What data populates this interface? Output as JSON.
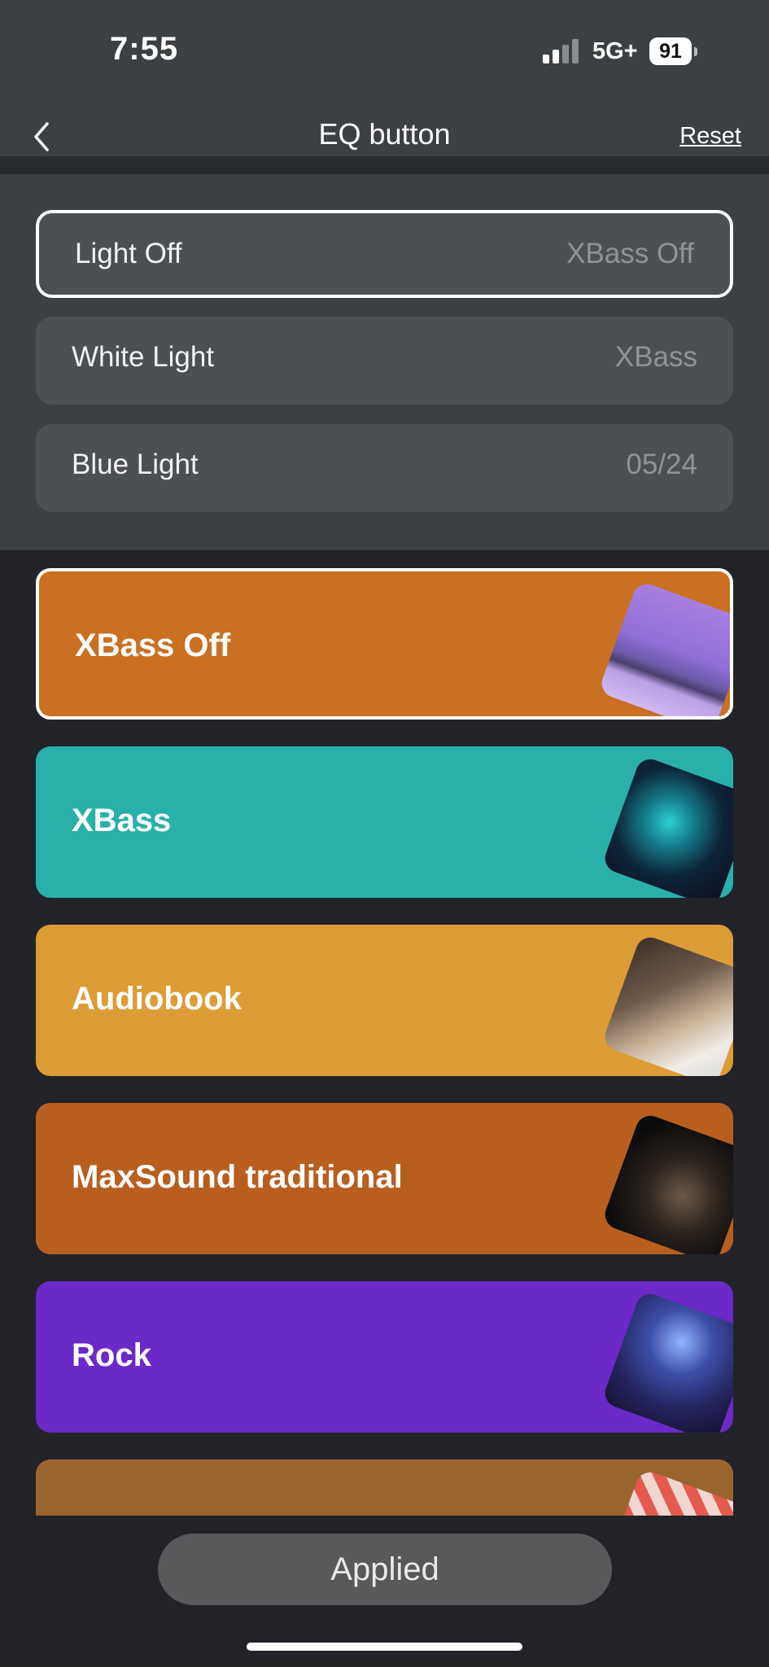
{
  "status": {
    "time": "7:55",
    "network": "5G+",
    "battery": "91"
  },
  "nav": {
    "title": "EQ button",
    "reset_label": "Reset"
  },
  "options": [
    {
      "label": "Light Off",
      "value": "XBass Off",
      "selected": true
    },
    {
      "label": "White Light",
      "value": "XBass",
      "selected": false
    },
    {
      "label": "Blue Light",
      "value": "05/24",
      "selected": false
    }
  ],
  "presets": [
    {
      "name": "XBass Off",
      "color": "#c97022",
      "selected": true
    },
    {
      "name": "XBass",
      "color": "#29b0aa",
      "selected": false
    },
    {
      "name": "Audiobook",
      "color": "#dc9c36",
      "selected": false
    },
    {
      "name": "MaxSound traditional",
      "color": "#b85f20",
      "selected": false
    },
    {
      "name": "Rock",
      "color": "#6b29c8",
      "selected": false
    },
    {
      "name": "",
      "color": "#9a652d",
      "selected": false
    }
  ],
  "footer": {
    "applied_label": "Applied"
  }
}
